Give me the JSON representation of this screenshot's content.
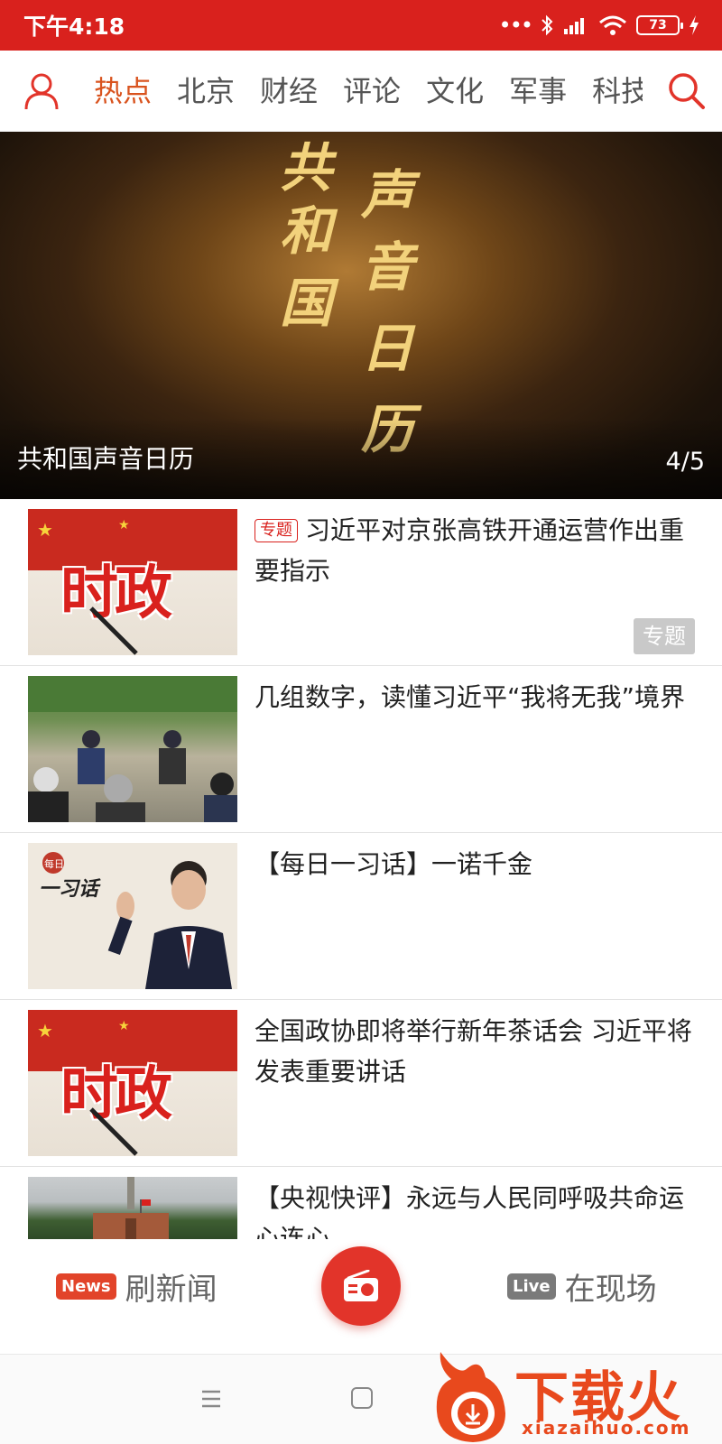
{
  "status": {
    "time": "下午4:18",
    "dots": "•••",
    "battery": "73"
  },
  "nav": {
    "tabs": [
      "热点",
      "北京",
      "财经",
      "评论",
      "文化",
      "军事",
      "科技"
    ]
  },
  "banner": {
    "caption": "共和国声音日历",
    "index": "4/5",
    "art_text": "共和国声音日历"
  },
  "news": [
    {
      "tag": "专题",
      "title": "习近平对京张高铁开通运营作出重要指示",
      "badge": "专题",
      "thumb_text": "时政"
    },
    {
      "title": "几组数字，读懂习近平“我将无我”境界"
    },
    {
      "title": "【每日一习话】一诺千金",
      "thumb_label_small": "每日",
      "thumb_label_big": "一习话"
    },
    {
      "title": "全国政协即将举行新年茶话会 习近平将发表重要讲话",
      "thumb_text": "时政"
    },
    {
      "title": "【央视快评】永远与人民同呼吸共命运心连心"
    }
  ],
  "bottom": {
    "news_badge": "News",
    "news_label": "刷新闻",
    "live_badge": "Live",
    "live_label": "在现场"
  },
  "watermark": {
    "title": "下载火",
    "url": "xiazaihuo.com"
  },
  "colors": {
    "primary": "#d9211d",
    "active_tab": "#d9531e",
    "text": "#222222"
  }
}
